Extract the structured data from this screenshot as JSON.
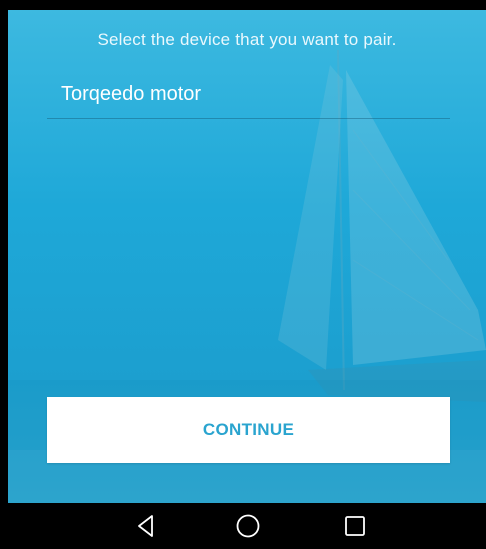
{
  "screen": {
    "instruction": "Select the device that you want to pair.",
    "devices": [
      {
        "name": "Torqeedo motor"
      }
    ],
    "continue_label": "CONTINUE"
  },
  "nav": {
    "back_icon": "back-triangle-icon",
    "home_icon": "home-circle-icon",
    "recents_icon": "recents-square-icon"
  },
  "colors": {
    "background": "#1ea8d8",
    "button_text": "#2aa4cf",
    "nav_bar": "#000000"
  }
}
